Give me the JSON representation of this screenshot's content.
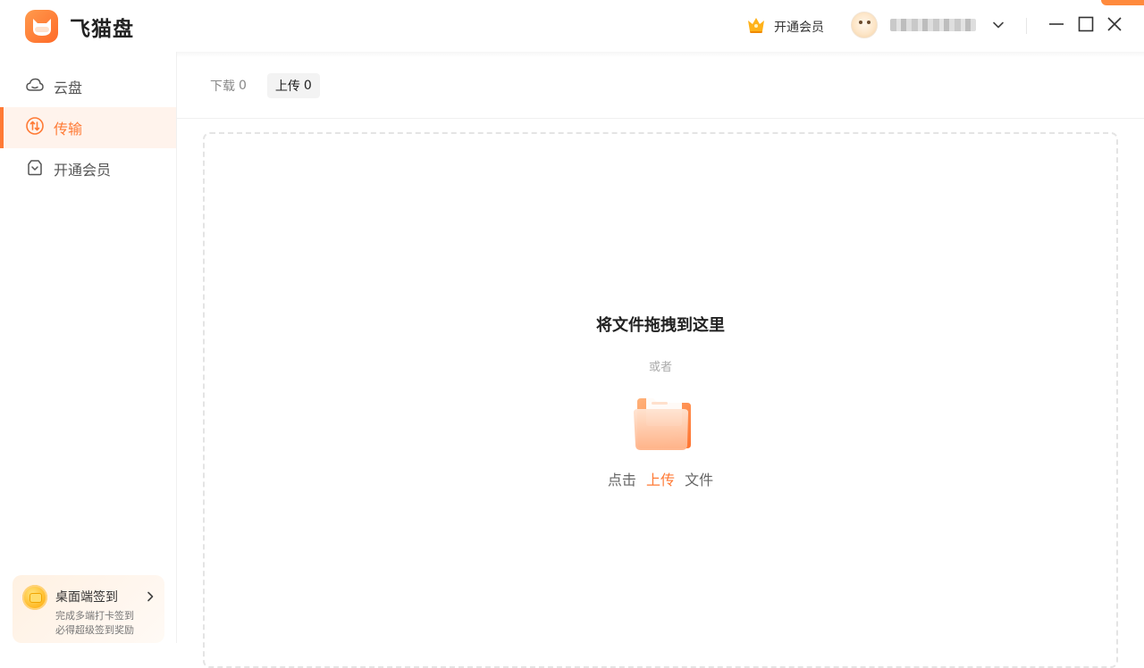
{
  "app": {
    "name": "飞猫盘"
  },
  "header": {
    "vip_label": "开通会员",
    "username": "██████████"
  },
  "sidebar": {
    "items": [
      {
        "label": "云盘",
        "icon": "cloud-icon"
      },
      {
        "label": "传输",
        "icon": "transfer-icon",
        "active": true
      },
      {
        "label": "开通会员",
        "icon": "vip-bag-icon"
      }
    ],
    "checkin": {
      "title": "桌面端签到",
      "line1": "完成多端打卡签到",
      "line2": "必得超级签到奖励"
    }
  },
  "tabs": [
    {
      "label": "下载",
      "count": "0",
      "active": false
    },
    {
      "label": "上传",
      "count": "0",
      "active": true
    }
  ],
  "dropzone": {
    "title": "将文件拖拽到这里",
    "or": "或者",
    "action_prefix": "点击",
    "action_link": "上传",
    "action_suffix": "文件"
  },
  "colors": {
    "accent": "#ff7a35",
    "active_bg": "#fff3ec"
  }
}
